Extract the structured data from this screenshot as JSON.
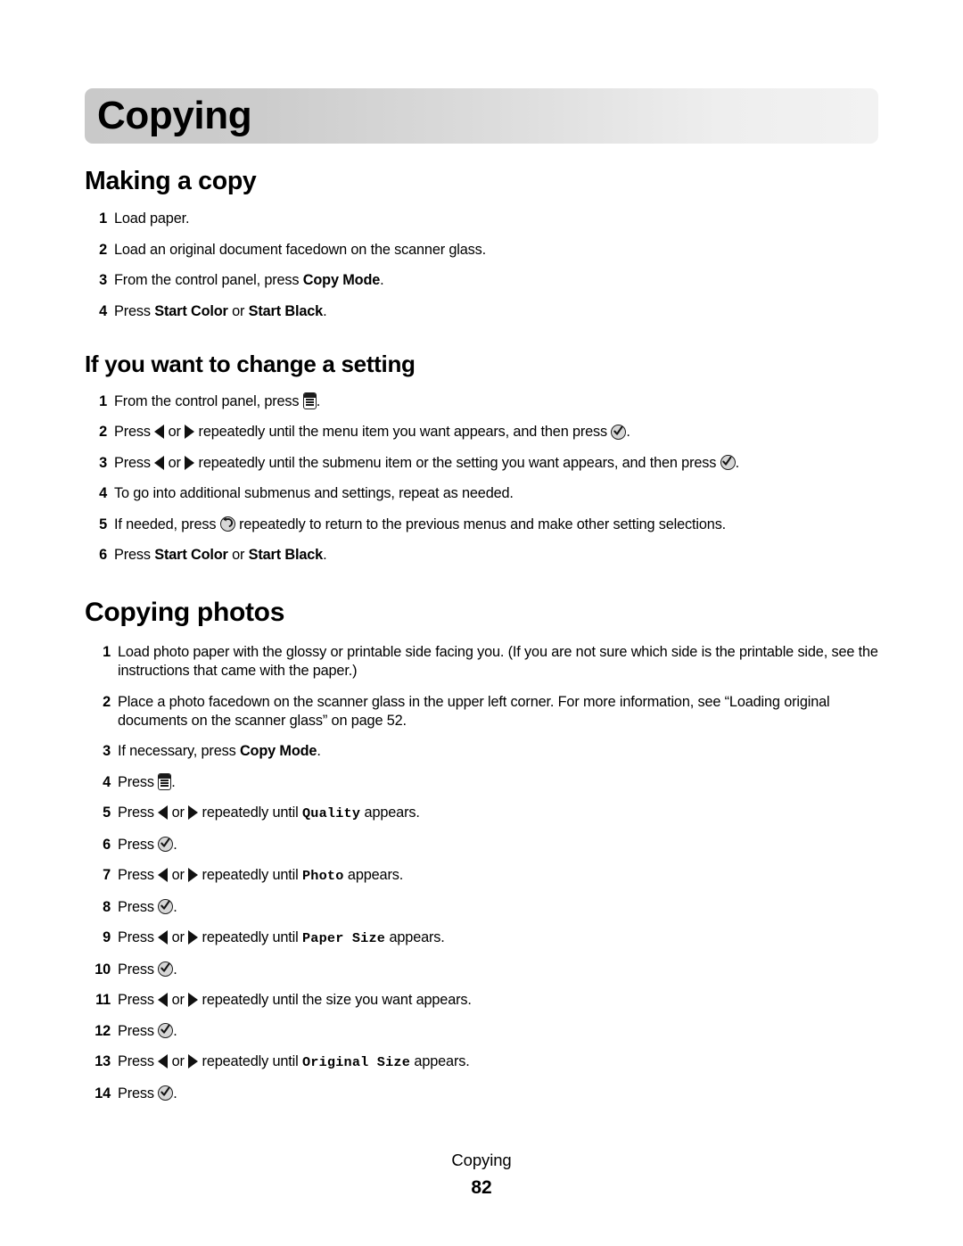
{
  "document": {
    "chapter_title": "Copying",
    "footer": {
      "running_head": "Copying",
      "page_number": "82"
    }
  },
  "sections": [
    {
      "id": "making-a-copy",
      "heading": "Making a copy",
      "steps": [
        {
          "num": "1",
          "parts": [
            {
              "t": "text",
              "v": "Load paper."
            }
          ]
        },
        {
          "num": "2",
          "parts": [
            {
              "t": "text",
              "v": "Load an original document facedown on the scanner glass."
            }
          ]
        },
        {
          "num": "3",
          "parts": [
            {
              "t": "text",
              "v": "From the control panel, press "
            },
            {
              "t": "bold",
              "v": "Copy Mode"
            },
            {
              "t": "text",
              "v": "."
            }
          ]
        },
        {
          "num": "4",
          "parts": [
            {
              "t": "text",
              "v": "Press "
            },
            {
              "t": "bold",
              "v": "Start Color"
            },
            {
              "t": "text",
              "v": " or "
            },
            {
              "t": "bold",
              "v": "Start Black"
            },
            {
              "t": "text",
              "v": "."
            }
          ]
        }
      ]
    },
    {
      "id": "if-you-want-to-change-a-setting",
      "heading": "If you want to change a setting",
      "steps": [
        {
          "num": "1",
          "parts": [
            {
              "t": "text",
              "v": "From the control panel, press "
            },
            {
              "t": "icon",
              "v": "menu-icon"
            },
            {
              "t": "text",
              "v": "."
            }
          ]
        },
        {
          "num": "2",
          "parts": [
            {
              "t": "text",
              "v": "Press "
            },
            {
              "t": "icon",
              "v": "left-arrow-icon"
            },
            {
              "t": "text",
              "v": " or "
            },
            {
              "t": "icon",
              "v": "right-arrow-icon"
            },
            {
              "t": "text",
              "v": " repeatedly until the menu item you want appears, and then press "
            },
            {
              "t": "icon",
              "v": "select-icon"
            },
            {
              "t": "text",
              "v": "."
            }
          ]
        },
        {
          "num": "3",
          "parts": [
            {
              "t": "text",
              "v": "Press "
            },
            {
              "t": "icon",
              "v": "left-arrow-icon"
            },
            {
              "t": "text",
              "v": " or "
            },
            {
              "t": "icon",
              "v": "right-arrow-icon"
            },
            {
              "t": "text",
              "v": " repeatedly until the submenu item or the setting you want appears, and then press "
            },
            {
              "t": "icon",
              "v": "select-icon"
            },
            {
              "t": "text",
              "v": "."
            }
          ]
        },
        {
          "num": "4",
          "parts": [
            {
              "t": "text",
              "v": "To go into additional submenus and settings, repeat as needed."
            }
          ]
        },
        {
          "num": "5",
          "parts": [
            {
              "t": "text",
              "v": "If needed, press "
            },
            {
              "t": "icon",
              "v": "back-icon"
            },
            {
              "t": "text",
              "v": " repeatedly to return to the previous menus and make other setting selections."
            }
          ]
        },
        {
          "num": "6",
          "parts": [
            {
              "t": "text",
              "v": "Press "
            },
            {
              "t": "bold",
              "v": "Start Color"
            },
            {
              "t": "text",
              "v": " or "
            },
            {
              "t": "bold",
              "v": "Start Black"
            },
            {
              "t": "text",
              "v": "."
            }
          ]
        }
      ]
    },
    {
      "id": "copying-photos",
      "heading": "Copying photos",
      "steps": [
        {
          "num": "1",
          "parts": [
            {
              "t": "text",
              "v": "Load photo paper with the glossy or printable side facing you. (If you are not sure which side is the printable side, see the instructions that came with the paper.)"
            }
          ]
        },
        {
          "num": "2",
          "parts": [
            {
              "t": "text",
              "v": "Place a photo facedown on the scanner glass in the upper left corner. For more information, see “Loading original documents on the scanner glass” on page 52."
            }
          ]
        },
        {
          "num": "3",
          "parts": [
            {
              "t": "text",
              "v": "If necessary, press "
            },
            {
              "t": "bold",
              "v": "Copy Mode"
            },
            {
              "t": "text",
              "v": "."
            }
          ]
        },
        {
          "num": "4",
          "parts": [
            {
              "t": "text",
              "v": "Press "
            },
            {
              "t": "icon",
              "v": "menu-icon"
            },
            {
              "t": "text",
              "v": "."
            }
          ]
        },
        {
          "num": "5",
          "parts": [
            {
              "t": "text",
              "v": "Press "
            },
            {
              "t": "icon",
              "v": "left-arrow-icon"
            },
            {
              "t": "text",
              "v": " or "
            },
            {
              "t": "icon",
              "v": "right-arrow-icon"
            },
            {
              "t": "text",
              "v": " repeatedly until "
            },
            {
              "t": "mono",
              "v": "Quality"
            },
            {
              "t": "text",
              "v": " appears."
            }
          ]
        },
        {
          "num": "6",
          "parts": [
            {
              "t": "text",
              "v": "Press "
            },
            {
              "t": "icon",
              "v": "select-icon"
            },
            {
              "t": "text",
              "v": "."
            }
          ]
        },
        {
          "num": "7",
          "parts": [
            {
              "t": "text",
              "v": "Press "
            },
            {
              "t": "icon",
              "v": "left-arrow-icon"
            },
            {
              "t": "text",
              "v": " or "
            },
            {
              "t": "icon",
              "v": "right-arrow-icon"
            },
            {
              "t": "text",
              "v": " repeatedly until "
            },
            {
              "t": "mono",
              "v": "Photo"
            },
            {
              "t": "text",
              "v": " appears."
            }
          ]
        },
        {
          "num": "8",
          "parts": [
            {
              "t": "text",
              "v": "Press "
            },
            {
              "t": "icon",
              "v": "select-icon"
            },
            {
              "t": "text",
              "v": "."
            }
          ]
        },
        {
          "num": "9",
          "parts": [
            {
              "t": "text",
              "v": "Press "
            },
            {
              "t": "icon",
              "v": "left-arrow-icon"
            },
            {
              "t": "text",
              "v": " or "
            },
            {
              "t": "icon",
              "v": "right-arrow-icon"
            },
            {
              "t": "text",
              "v": " repeatedly until "
            },
            {
              "t": "mono",
              "v": "Paper Size"
            },
            {
              "t": "text",
              "v": " appears."
            }
          ]
        },
        {
          "num": "10",
          "parts": [
            {
              "t": "text",
              "v": "Press "
            },
            {
              "t": "icon",
              "v": "select-icon"
            },
            {
              "t": "text",
              "v": "."
            }
          ]
        },
        {
          "num": "11",
          "parts": [
            {
              "t": "text",
              "v": "Press "
            },
            {
              "t": "icon",
              "v": "left-arrow-icon"
            },
            {
              "t": "text",
              "v": " or "
            },
            {
              "t": "icon",
              "v": "right-arrow-icon"
            },
            {
              "t": "text",
              "v": " repeatedly until the size you want appears."
            }
          ]
        },
        {
          "num": "12",
          "parts": [
            {
              "t": "text",
              "v": "Press "
            },
            {
              "t": "icon",
              "v": "select-icon"
            },
            {
              "t": "text",
              "v": "."
            }
          ]
        },
        {
          "num": "13",
          "parts": [
            {
              "t": "text",
              "v": "Press "
            },
            {
              "t": "icon",
              "v": "left-arrow-icon"
            },
            {
              "t": "text",
              "v": " or "
            },
            {
              "t": "icon",
              "v": "right-arrow-icon"
            },
            {
              "t": "text",
              "v": " repeatedly until "
            },
            {
              "t": "mono",
              "v": "Original Size"
            },
            {
              "t": "text",
              "v": " appears."
            }
          ]
        },
        {
          "num": "14",
          "parts": [
            {
              "t": "text",
              "v": "Press "
            },
            {
              "t": "icon",
              "v": "select-icon"
            },
            {
              "t": "text",
              "v": "."
            }
          ]
        }
      ]
    }
  ],
  "colors": {
    "banner_gradient_start": "#c9c9c9",
    "banner_gradient_end": "#f2f2f2",
    "text": "#000000",
    "icon_fill": "#d7d7d7",
    "icon_stroke": "#1d1d1d"
  }
}
